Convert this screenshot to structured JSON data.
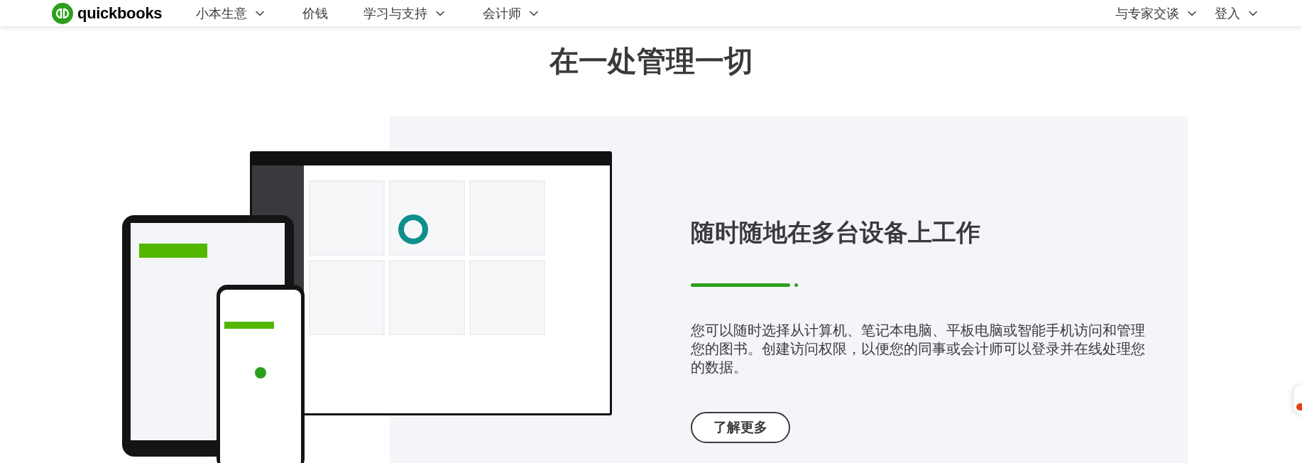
{
  "header": {
    "logo": "quickbooks",
    "nav": [
      {
        "label": "小本生意",
        "dropdown": true
      },
      {
        "label": "价钱",
        "dropdown": false
      },
      {
        "label": "学习与支持",
        "dropdown": true
      },
      {
        "label": "会计师",
        "dropdown": true
      }
    ],
    "actions": [
      {
        "label": "与专家交谈",
        "dropdown": true
      },
      {
        "label": "登入",
        "dropdown": true
      }
    ]
  },
  "title": "在一处管理一切",
  "feature": {
    "heading": "随时随地在多台设备上工作",
    "body": "您可以随时选择从计算机、笔记本电脑、平板电脑或智能手机访问和管理您的图书。创建访问权限，以便您的同事或会计师可以登录并在线处理您的数据。",
    "button": "了解更多"
  }
}
